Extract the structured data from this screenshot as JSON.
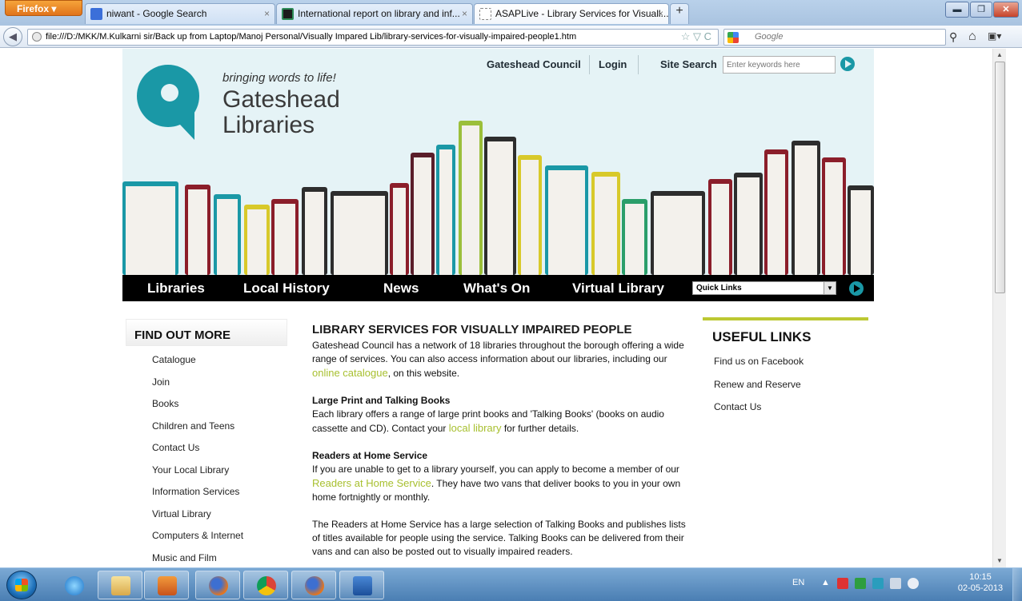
{
  "browser": {
    "menu_button_label": "Firefox ▾",
    "tabs": [
      {
        "title": "niwant - Google Search",
        "icon": "google-favicon",
        "active": false
      },
      {
        "title": "International report on library and inf...",
        "icon": "document-favicon",
        "active": false
      },
      {
        "title": "ASAPLive - Library Services for Visuall...",
        "icon": "blank-page-favicon",
        "active": true
      }
    ],
    "tab_close_glyph": "×",
    "new_tab_glyph": "+",
    "url": "file:///D:/MKK/M.Kulkarni sir/Back up from Laptop/Manoj Personal/Visually Impared Lib/library-services-for-visually-impaired-people1.htm",
    "url_bar_icons": "☆ ▽ C",
    "search_placeholder": "Google",
    "window_controls": {
      "minimize": "▬",
      "maximize": "❐",
      "close": "✕"
    },
    "nav_glyphs": {
      "back": "◀",
      "search_go": "⚲",
      "home": "⌂",
      "bookmarks": "▣▾"
    }
  },
  "site": {
    "logo": {
      "tagline": "bringing words to life!",
      "name_line_1": "Gateshead",
      "name_line_2": "Libraries",
      "color": "#1a98a6"
    },
    "top_links": {
      "council": "Gateshead Council",
      "login": "Login",
      "site_search_label": "Site Search",
      "site_search_placeholder": "Enter keywords here"
    },
    "main_nav": [
      "Libraries",
      "Local History",
      "News",
      "What's On",
      "Virtual Library"
    ],
    "quick_links": {
      "selected": "Quick Links",
      "arrow": "▼"
    },
    "accent_color": "#bcc832",
    "link_color": "#a8c030"
  },
  "sidebar": {
    "title": "FIND OUT MORE",
    "items": [
      "Catalogue",
      "Join",
      "Books",
      "Children and Teens",
      "Contact Us",
      "Your Local Library",
      "Information Services",
      "Virtual Library",
      "Computers & Internet",
      "Music and Film"
    ]
  },
  "article": {
    "title": "LIBRARY SERVICES FOR VISUALLY IMPAIRED PEOPLE",
    "intro_before": "Gateshead Council has a network of 18 libraries throughout the borough offering a wide range of services. You can also access information about our libraries, including our ",
    "intro_link": "online catalogue",
    "intro_after": ", on this website.",
    "large_print_heading": "Large Print and Talking Books",
    "large_print_before": "Each library offers a range of large print books and 'Talking Books' (books on audio cassette and CD). Contact your ",
    "large_print_link": "local library",
    "large_print_after": " for further details.",
    "readers_heading": "Readers at Home Service",
    "readers_before": "If you are unable to get to a library yourself, you can apply to become a member of our ",
    "readers_link": "Readers at Home Service",
    "readers_after": ". They have two vans that deliver books to you in your own home fortnightly or monthly.",
    "final_paragraph": "The Readers at Home Service has a large selection of Talking Books and publishes lists of titles available for people using the service. Talking Books can be delivered from their vans and can also be posted out to visually impaired readers."
  },
  "useful_links": {
    "title": "USEFUL LINKS",
    "items": [
      "Find us on Facebook",
      "Renew and Reserve",
      "Contact Us"
    ]
  },
  "taskbar": {
    "apps": [
      "internet-explorer-icon",
      "file-explorer-icon",
      "media-player-icon",
      "firefox-icon",
      "chrome-icon",
      "firefox-icon",
      "word-icon"
    ],
    "language": "EN",
    "tray_chevron": "▲",
    "clock_time": "10:15",
    "clock_date": "02-05-2013"
  }
}
